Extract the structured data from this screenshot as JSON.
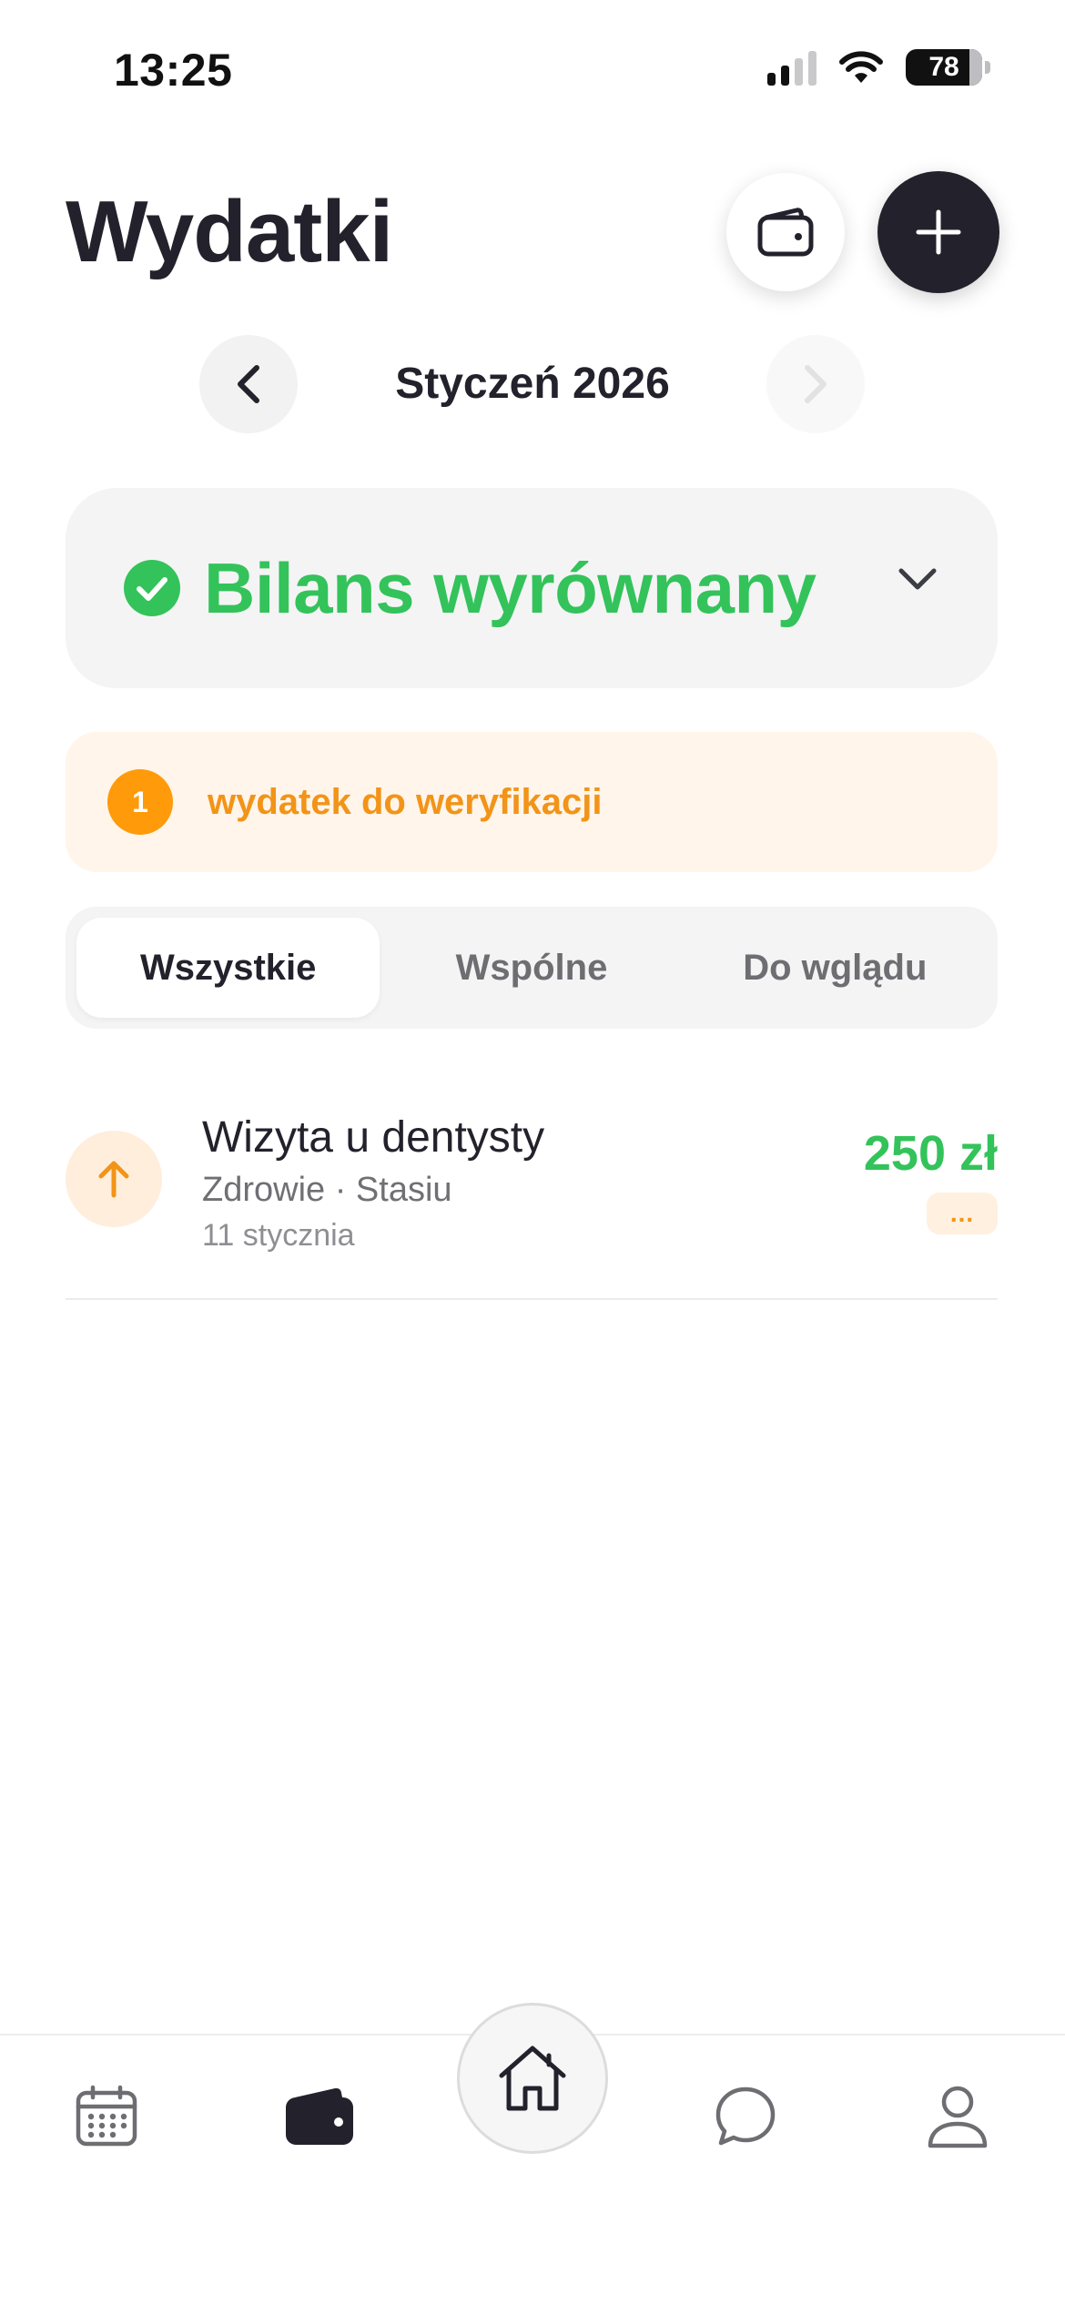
{
  "status_bar": {
    "time": "13:25",
    "battery": "78"
  },
  "header": {
    "title": "Wydatki",
    "icons": [
      "wallet-icon",
      "plus-icon"
    ]
  },
  "month_nav": {
    "label": "Styczeń 2026",
    "prev_icon": "chevron-left-icon",
    "next_icon": "chevron-right-icon"
  },
  "balance": {
    "text": "Bilans wyrównany",
    "icon": "check-circle-icon",
    "color": "#33c35a"
  },
  "verification": {
    "count": "1",
    "text": "wydatek do weryfikacji",
    "color": "#f29418"
  },
  "tabs": [
    {
      "label": "Wszystkie",
      "active": true
    },
    {
      "label": "Wspólne",
      "active": false
    },
    {
      "label": "Do wglądu",
      "active": false
    }
  ],
  "expenses": [
    {
      "icon": "arrow-up-icon",
      "title": "Wizyta u dentysty",
      "subtitle": "Zdrowie · Stasiu",
      "date": "11 stycznia",
      "amount": "250 zł",
      "status": "..."
    }
  ],
  "bottom_nav": {
    "items": [
      "calendar-icon",
      "wallet-icon",
      "home-icon",
      "chat-icon",
      "profile-icon"
    ],
    "active": "wallet-icon"
  }
}
